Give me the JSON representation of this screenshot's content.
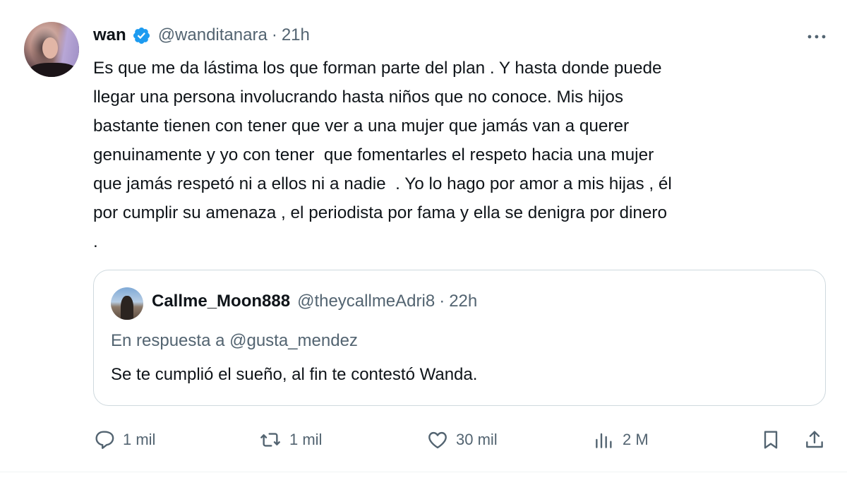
{
  "author": {
    "name": "wan",
    "handle": "@wanditanara",
    "separator": "·",
    "time": "21h",
    "verified": true
  },
  "tweet": {
    "text": "Es que me da lástima los que forman parte del plan . Y hasta donde puede\nllegar una persona involucrando hasta niños que no conoce. Mis hijos\nbastante tienen con tener que ver a una mujer que jamás van a querer\ngenuinamente y yo con tener  que fomentarles el respeto hacia una mujer\nque jamás respetó ni a ellos ni a nadie  . Yo lo hago por amor a mis hijas , él\npor cumplir su amenaza , el periodista por fama y ella se denigra por dinero\n."
  },
  "quoted": {
    "name": "Callme_Moon888",
    "handle": "@theycallmeAdri8",
    "separator": "·",
    "time": "22h",
    "reply_to": "En respuesta a @gusta_mendez",
    "text": "Se te cumplió el sueño, al fin te contestó Wanda."
  },
  "actions": {
    "replies": "1 mil",
    "reposts": "1 mil",
    "likes": "30 mil",
    "views": "2 M"
  },
  "icons": {
    "more": "more-icon",
    "verified": "verified-badge-icon",
    "reply": "reply-icon",
    "repost": "repost-icon",
    "like": "heart-icon",
    "views": "views-icon",
    "bookmark": "bookmark-icon",
    "share": "share-icon"
  },
  "colors": {
    "text": "#0f1419",
    "secondary": "#536471",
    "verified": "#1d9bf0",
    "border": "#cfd9de"
  }
}
